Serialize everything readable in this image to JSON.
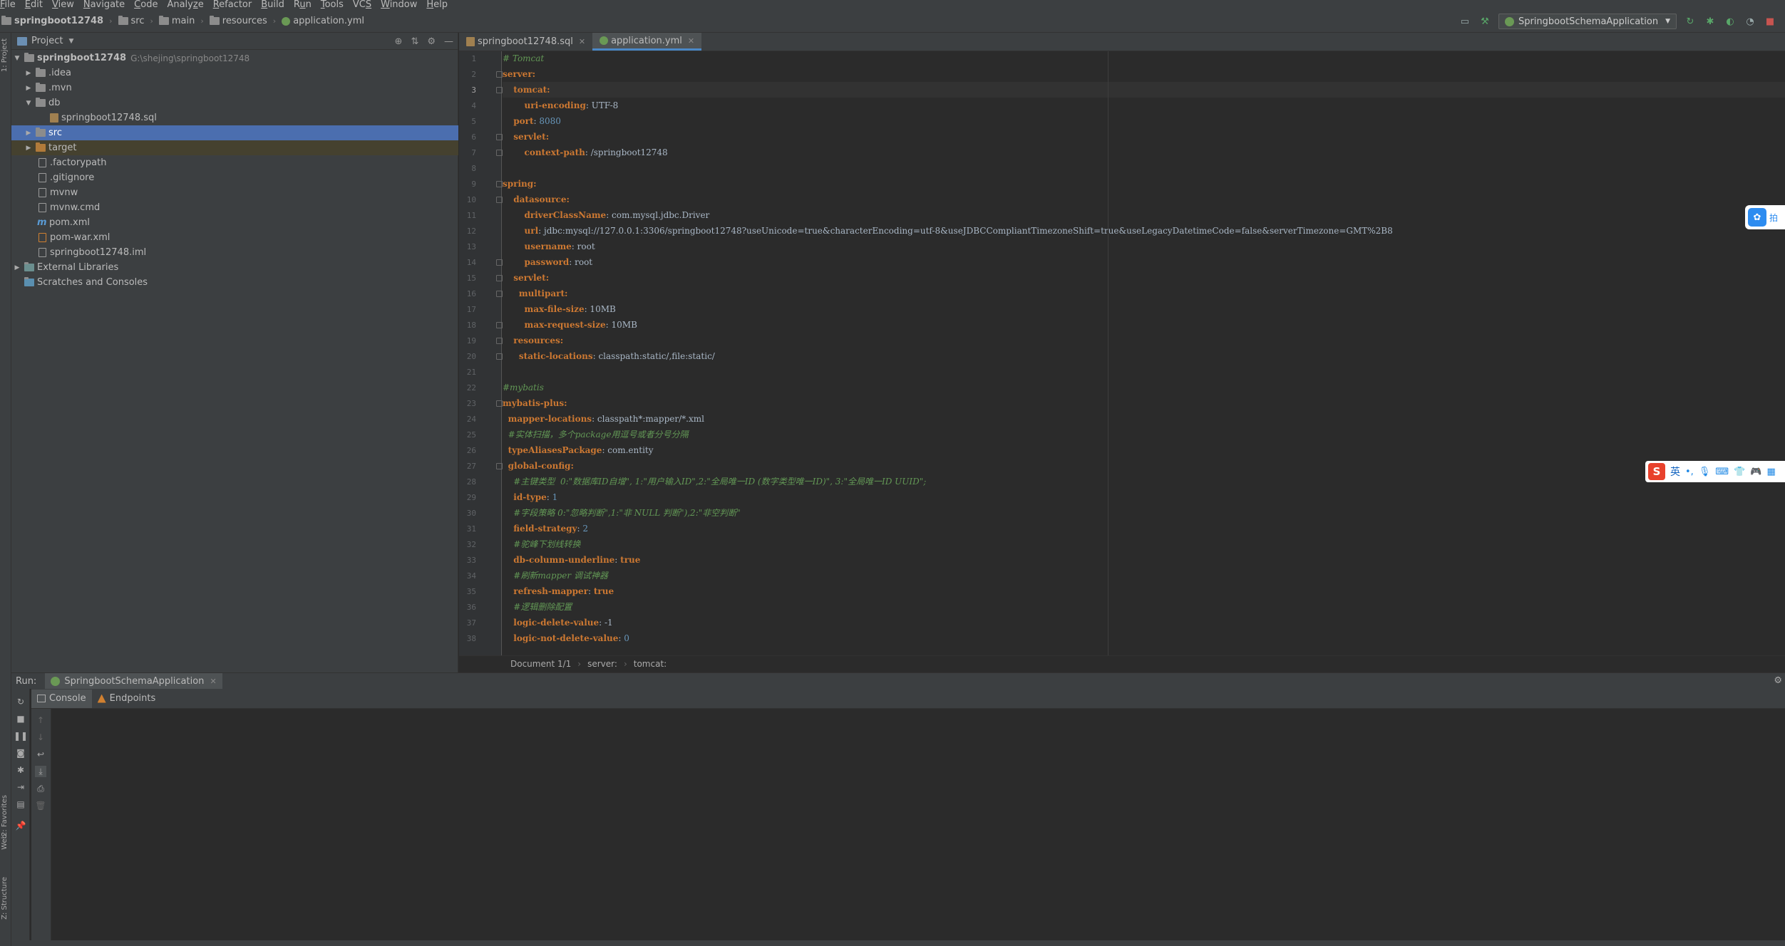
{
  "menu": [
    {
      "pre": "",
      "u": "F",
      "post": "ile"
    },
    {
      "pre": "",
      "u": "E",
      "post": "dit"
    },
    {
      "pre": "",
      "u": "V",
      "post": "iew"
    },
    {
      "pre": "",
      "u": "N",
      "post": "avigate"
    },
    {
      "pre": "",
      "u": "C",
      "post": "ode"
    },
    {
      "pre": "Analy",
      "u": "z",
      "post": "e"
    },
    {
      "pre": "",
      "u": "R",
      "post": "efactor"
    },
    {
      "pre": "",
      "u": "B",
      "post": "uild"
    },
    {
      "pre": "R",
      "u": "u",
      "post": "n"
    },
    {
      "pre": "",
      "u": "T",
      "post": "ools"
    },
    {
      "pre": "VC",
      "u": "S",
      "post": ""
    },
    {
      "pre": "",
      "u": "W",
      "post": "indow"
    },
    {
      "pre": "",
      "u": "H",
      "post": "elp"
    }
  ],
  "breadcrumb": {
    "project": "springboot12748",
    "src": "src",
    "main": "main",
    "resources": "resources",
    "file": "application.yml"
  },
  "run_config": {
    "label": "SpringbootSchemaApplication"
  },
  "left_strip": {
    "project": "1: Project",
    "favorites": "2: Favorites",
    "web": "Web",
    "structure": "Z: Structure"
  },
  "project_panel": {
    "title": "Project",
    "root_name": "springboot12748",
    "root_path": "G:\\shejing\\springboot12748",
    "items": {
      "idea": ".idea",
      "mvn": ".mvn",
      "db": "db",
      "sql": "springboot12748.sql",
      "src": "src",
      "target": "target",
      "factorypath": ".factorypath",
      "gitignore": ".gitignore",
      "mvnw": "mvnw",
      "mvnwcmd": "mvnw.cmd",
      "pom": "pom.xml",
      "pomwar": "pom-war.xml",
      "iml": "springboot12748.iml",
      "ext": "External Libraries",
      "scratches": "Scratches and Consoles"
    }
  },
  "editor": {
    "tabs": [
      {
        "label": "springboot12748.sql"
      },
      {
        "label": "application.yml"
      }
    ],
    "current_line": 3,
    "lines": [
      [
        {
          "t": "# Tomcat",
          "c": "c"
        }
      ],
      [
        {
          "t": "server:",
          "c": "k"
        }
      ],
      [
        {
          "t": "    ",
          "c": "v"
        },
        {
          "t": "tomcat:",
          "c": "k"
        }
      ],
      [
        {
          "t": "        ",
          "c": "v"
        },
        {
          "t": "uri-encoding",
          "c": "k"
        },
        {
          "t": ": UTF-8",
          "c": "v"
        }
      ],
      [
        {
          "t": "    ",
          "c": "v"
        },
        {
          "t": "port",
          "c": "k"
        },
        {
          "t": ": ",
          "c": "v"
        },
        {
          "t": "8080",
          "c": "n"
        }
      ],
      [
        {
          "t": "    ",
          "c": "v"
        },
        {
          "t": "servlet:",
          "c": "k"
        }
      ],
      [
        {
          "t": "        ",
          "c": "v"
        },
        {
          "t": "context-path",
          "c": "k"
        },
        {
          "t": ": /springboot12748",
          "c": "v"
        }
      ],
      [],
      [
        {
          "t": "spring:",
          "c": "k"
        }
      ],
      [
        {
          "t": "    ",
          "c": "v"
        },
        {
          "t": "datasource:",
          "c": "k"
        }
      ],
      [
        {
          "t": "        ",
          "c": "v"
        },
        {
          "t": "driverClassName",
          "c": "k"
        },
        {
          "t": ": com.mysql.jdbc.Driver",
          "c": "v"
        }
      ],
      [
        {
          "t": "        ",
          "c": "v"
        },
        {
          "t": "url",
          "c": "k"
        },
        {
          "t": ": jdbc:mysql://127.0.0.1:3306/springboot12748?useUnicode=true&characterEncoding=utf-8&useJDBCCompliantTimezoneShift=true&useLegacyDatetimeCode=false&serverTimezone=GMT%2B8",
          "c": "v"
        }
      ],
      [
        {
          "t": "        ",
          "c": "v"
        },
        {
          "t": "username",
          "c": "k"
        },
        {
          "t": ": root",
          "c": "v"
        }
      ],
      [
        {
          "t": "        ",
          "c": "v"
        },
        {
          "t": "password",
          "c": "k"
        },
        {
          "t": ": root",
          "c": "v"
        }
      ],
      [
        {
          "t": "    ",
          "c": "v"
        },
        {
          "t": "servlet:",
          "c": "k"
        }
      ],
      [
        {
          "t": "      ",
          "c": "v"
        },
        {
          "t": "multipart:",
          "c": "k"
        }
      ],
      [
        {
          "t": "        ",
          "c": "v"
        },
        {
          "t": "max-file-size",
          "c": "k"
        },
        {
          "t": ": 10MB",
          "c": "v"
        }
      ],
      [
        {
          "t": "        ",
          "c": "v"
        },
        {
          "t": "max-request-size",
          "c": "k"
        },
        {
          "t": ": 10MB",
          "c": "v"
        }
      ],
      [
        {
          "t": "    ",
          "c": "v"
        },
        {
          "t": "resources:",
          "c": "k"
        }
      ],
      [
        {
          "t": "      ",
          "c": "v"
        },
        {
          "t": "static-locations",
          "c": "k"
        },
        {
          "t": ": classpath:static/,file:static/",
          "c": "v"
        }
      ],
      [],
      [
        {
          "t": "#mybatis",
          "c": "c"
        }
      ],
      [
        {
          "t": "mybatis-plus:",
          "c": "k"
        }
      ],
      [
        {
          "t": "  ",
          "c": "v"
        },
        {
          "t": "mapper-locations",
          "c": "k"
        },
        {
          "t": ": classpath*:mapper/*.xml",
          "c": "v"
        }
      ],
      [
        {
          "t": "  ",
          "c": "v"
        },
        {
          "t": "#实体扫描，多个package用逗号或者分号分隔",
          "c": "c"
        }
      ],
      [
        {
          "t": "  ",
          "c": "v"
        },
        {
          "t": "typeAliasesPackage",
          "c": "k"
        },
        {
          "t": ": com.entity",
          "c": "v"
        }
      ],
      [
        {
          "t": "  ",
          "c": "v"
        },
        {
          "t": "global-config:",
          "c": "k"
        }
      ],
      [
        {
          "t": "    ",
          "c": "v"
        },
        {
          "t": "#主键类型  0:\"数据库ID自增\", 1:\"用户输入ID\",2:\"全局唯一ID (数字类型唯一ID)\", 3:\"全局唯一ID UUID\";",
          "c": "c"
        }
      ],
      [
        {
          "t": "    ",
          "c": "v"
        },
        {
          "t": "id-type",
          "c": "k"
        },
        {
          "t": ": ",
          "c": "v"
        },
        {
          "t": "1",
          "c": "n"
        }
      ],
      [
        {
          "t": "    ",
          "c": "v"
        },
        {
          "t": "#字段策略 0:\"忽略判断\",1:\"非 NULL 判断\"),2:\"非空判断\"",
          "c": "c"
        }
      ],
      [
        {
          "t": "    ",
          "c": "v"
        },
        {
          "t": "field-strategy",
          "c": "k"
        },
        {
          "t": ": ",
          "c": "v"
        },
        {
          "t": "2",
          "c": "n"
        }
      ],
      [
        {
          "t": "    ",
          "c": "v"
        },
        {
          "t": "#驼峰下划线转换",
          "c": "c"
        }
      ],
      [
        {
          "t": "    ",
          "c": "v"
        },
        {
          "t": "db-column-underline",
          "c": "k"
        },
        {
          "t": ": ",
          "c": "v"
        },
        {
          "t": "true",
          "c": "k"
        }
      ],
      [
        {
          "t": "    ",
          "c": "v"
        },
        {
          "t": "#刷新mapper 调试神器",
          "c": "c"
        }
      ],
      [
        {
          "t": "    ",
          "c": "v"
        },
        {
          "t": "refresh-mapper",
          "c": "k"
        },
        {
          "t": ": ",
          "c": "v"
        },
        {
          "t": "true",
          "c": "k"
        }
      ],
      [
        {
          "t": "    ",
          "c": "v"
        },
        {
          "t": "#逻辑删除配置",
          "c": "c"
        }
      ],
      [
        {
          "t": "    ",
          "c": "v"
        },
        {
          "t": "logic-delete-value",
          "c": "k"
        },
        {
          "t": ": -1",
          "c": "v"
        }
      ],
      [
        {
          "t": "    ",
          "c": "v"
        },
        {
          "t": "logic-not-delete-value",
          "c": "k"
        },
        {
          "t": ": ",
          "c": "v"
        },
        {
          "t": "0",
          "c": "n"
        }
      ]
    ],
    "breadcrumb": {
      "doc": "Document 1/1",
      "server": "server:",
      "tomcat": "tomcat:"
    }
  },
  "ime": {
    "baidu_label": "拍",
    "lang": "英"
  },
  "run_panel": {
    "label": "Run:",
    "tab": "SpringbootSchemaApplication",
    "console_tab": "Console",
    "endpoints_tab": "Endpoints"
  }
}
